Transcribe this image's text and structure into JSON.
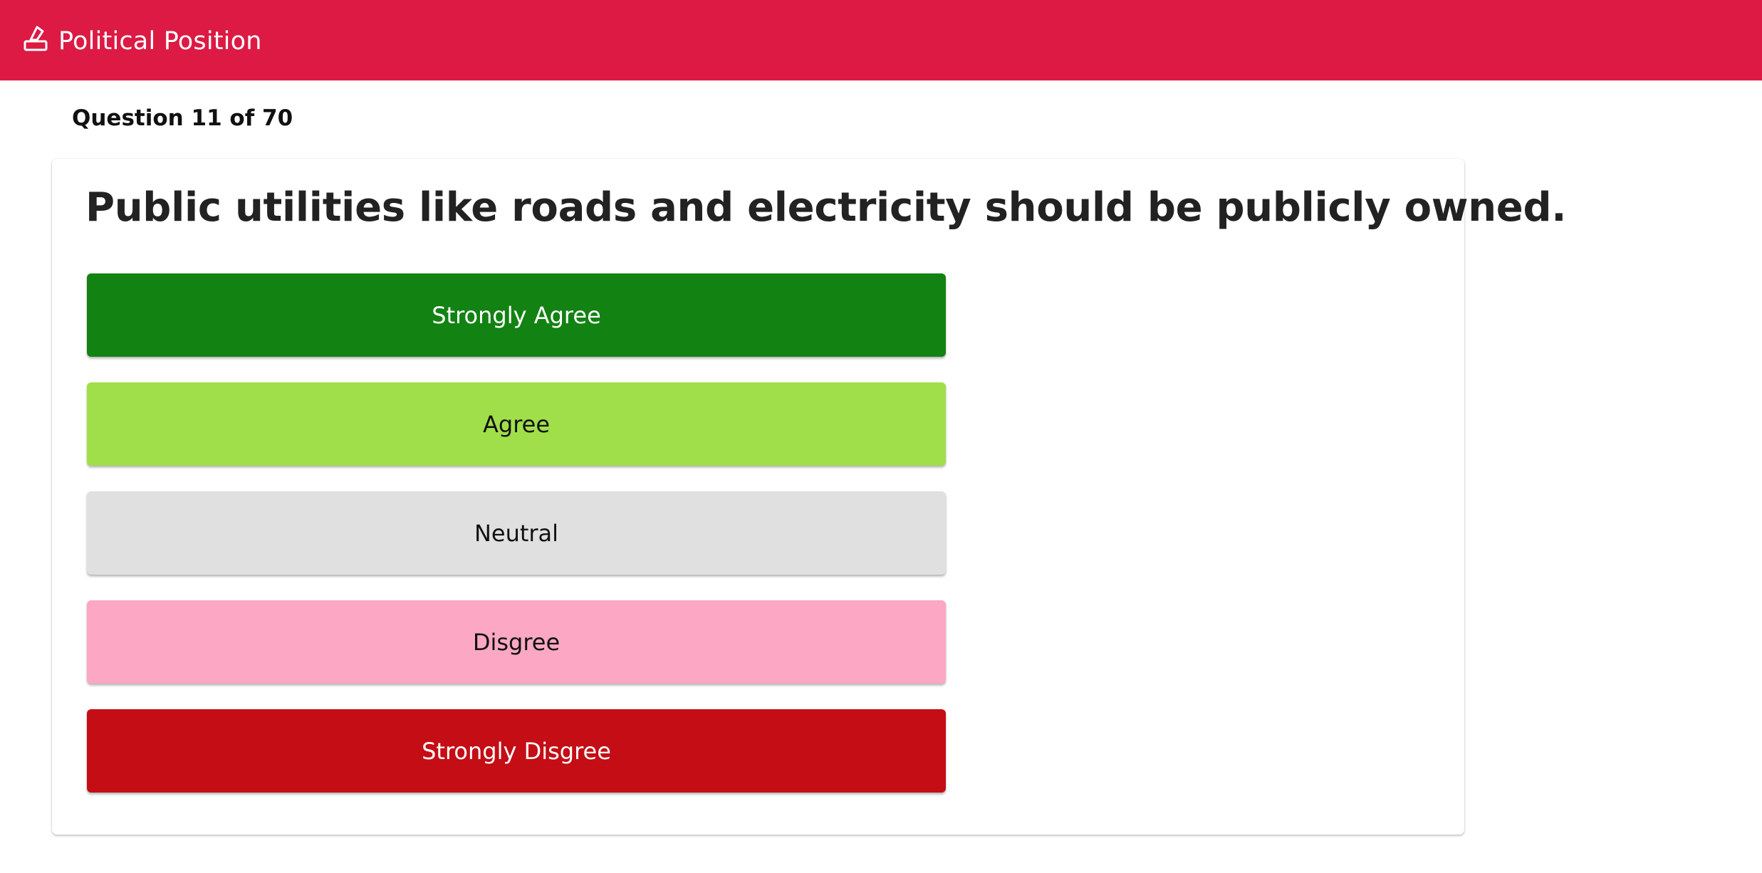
{
  "app": {
    "title": "Political Position",
    "icon": "ballot-icon",
    "brand_color": "#dc1a43"
  },
  "quiz": {
    "progress_label": "Question 11 of 70",
    "current": 11,
    "total": 70,
    "question": "Public utilities like roads and electricity should be publicly owned.",
    "answers": [
      {
        "label": "Strongly Agree",
        "bg": "#128212",
        "fg": "#ffffff"
      },
      {
        "label": "Agree",
        "bg": "#a0df4a",
        "fg": "#111111"
      },
      {
        "label": "Neutral",
        "bg": "#e0e0e0",
        "fg": "#111111"
      },
      {
        "label": "Disgree",
        "bg": "#fca8c4",
        "fg": "#111111"
      },
      {
        "label": "Strongly Disgree",
        "bg": "#c50d15",
        "fg": "#ffffff"
      }
    ]
  }
}
